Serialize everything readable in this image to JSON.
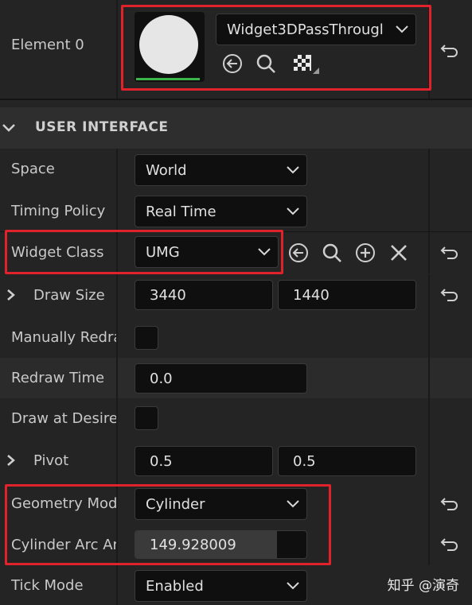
{
  "element0": {
    "label": "Element 0",
    "class_value": "Widget3DPassThrougl"
  },
  "section": {
    "title": "USER INTERFACE"
  },
  "rows": {
    "space": {
      "label": "Space",
      "value": "World"
    },
    "timing_policy": {
      "label": "Timing Policy",
      "value": "Real Time"
    },
    "widget_class": {
      "label": "Widget Class",
      "value": "UMG"
    },
    "draw_size": {
      "label": "Draw Size",
      "x": "3440",
      "y": "1440"
    },
    "manually_redraw": {
      "label": "Manually Redra"
    },
    "redraw_time": {
      "label": "Redraw Time",
      "value": "0.0"
    },
    "draw_at_desired": {
      "label": "Draw at Desirec"
    },
    "pivot": {
      "label": "Pivot",
      "x": "0.5",
      "y": "0.5"
    },
    "geometry_mode": {
      "label": "Geometry Mode",
      "value": "Cylinder"
    },
    "cylinder_arc": {
      "label": "Cylinder Arc An",
      "value": "149.928009",
      "fill_fraction": 0.83
    },
    "tick_mode": {
      "label": "Tick Mode",
      "value": "Enabled"
    }
  },
  "watermark": "知乎 @演奇",
  "colors": {
    "highlight_box": "#e0232a",
    "accent_green": "#3bb54a",
    "panel_bg": "#242424",
    "field_bg": "#0f0f0f"
  },
  "icons": [
    "chevron-down-icon",
    "browse-back-icon",
    "search-icon",
    "add-icon",
    "clear-icon",
    "reset-arrow-icon",
    "expand-arrow-icon",
    "checker-icon"
  ]
}
